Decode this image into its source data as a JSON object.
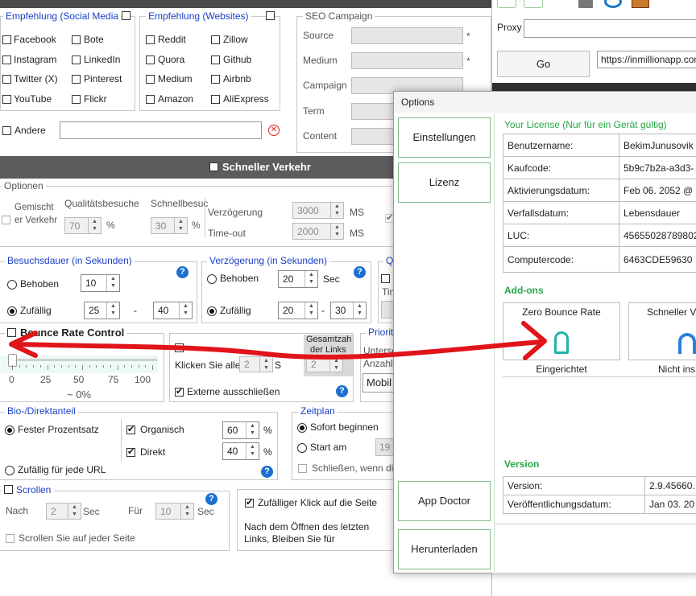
{
  "referral_social": {
    "title": "Empfehlung (Social Media",
    "items": [
      "Facebook",
      "Bote",
      "Instagram",
      "LinkedIn",
      "Twitter (X)",
      "Pinterest",
      "YouTube",
      "Flickr"
    ]
  },
  "referral_websites": {
    "title": "Empfehlung (Websites)",
    "items": [
      "Reddit",
      "Zillow",
      "Quora",
      "Github",
      "Medium",
      "Airbnb",
      "Amazon",
      "AliExpress"
    ]
  },
  "other_label": "Andere",
  "seo": {
    "title": "SEO Campaign",
    "fields": [
      "Source",
      "Medium",
      "Campaign",
      "Term",
      "Content"
    ],
    "required_mark": "*"
  },
  "fast_traffic": "Schneller Verkehr",
  "options": {
    "title": "Optionen",
    "weighted_traffic": "Gemischt er Verkehr",
    "quality_visits": "Qualitätsbesuche",
    "quality_value": "70",
    "fast_visits": "Schnellbesuc",
    "fast_value": "30",
    "percent": "%",
    "delay": "Verzögerung",
    "delay_value": "3000",
    "timeout": "Time-out",
    "timeout_value": "2000",
    "ms": "MS"
  },
  "visit_duration": {
    "title": "Besuchsdauer (in Sekunden)",
    "hold": "Behoben",
    "hold_value": "10",
    "random": "Zufällig",
    "min": "25",
    "dash": "-",
    "max": "40"
  },
  "delay_group": {
    "title": "Verzögerung (in Sekunden)",
    "hold": "Behoben",
    "hold_value": "20",
    "sec": "Sec",
    "random": "Zufällig",
    "min": "20",
    "dash": "-",
    "max": "30"
  },
  "bounce": {
    "title": "Bounce Rate Control",
    "ticks": [
      "0",
      "25",
      "50",
      "75",
      "100"
    ],
    "value_text": "~ 0%"
  },
  "clicks": {
    "click_all": "Klicken Sie alle",
    "click_value": "2",
    "s": "S",
    "total": "Gesamtzah",
    "of_links": "der Links",
    "total_value": "2",
    "exclude_external": "Externe ausschließen"
  },
  "priority": {
    "title": "Priorit",
    "under": "Untersc",
    "count": "Anzahl",
    "device": "Mobil"
  },
  "bio": {
    "title": "Bio-/Direktanteil",
    "fixed": "Fester Prozentsatz",
    "organic": "Organisch",
    "organic_value": "60",
    "direct": "Direkt",
    "direct_value": "40",
    "percent": "%",
    "random": "Zufällig für jede URL"
  },
  "schedule": {
    "title": "Zeitplan",
    "start_now": "Sofort beginnen",
    "start_at": "Start am",
    "start_value": "19",
    "close": "Schließen, wenn die"
  },
  "scroll": {
    "title": "Scrollen",
    "after": "Nach",
    "after_value": "2",
    "sec": "Sec",
    "for": "Für",
    "for_value": "10",
    "every_page": "Scrollen Sie auf jeder Seite"
  },
  "random_click": {
    "label": "Zufälliger Klick auf die Seite",
    "after_open": "Nach dem Öffnen des letzten",
    "links_stay": "Links, Bleiben Sie für"
  },
  "browser": {
    "proxy": "Proxy",
    "go": "Go",
    "url": "https://inmillionapp.com"
  },
  "dialog": {
    "title": "Options",
    "nav": [
      "Einstellungen",
      "Lizenz",
      "App Doctor",
      "Herunterladen"
    ],
    "license_title": "Your License (Nur für ein Gerät gültig)",
    "license_rows": [
      [
        "Benutzername:",
        "BekimJunusovik"
      ],
      [
        "Kaufcode:",
        "5b9c7b2a-a3d3-"
      ],
      [
        "Aktivierungsdatum:",
        "Feb 06. 2052 @"
      ],
      [
        "Verfallsdatum:",
        "Lebensdauer"
      ],
      [
        "LUC:",
        "45655028789802"
      ],
      [
        "Computercode:",
        "6463CDE59630"
      ]
    ],
    "addons_title": "Add-ons",
    "addons": [
      {
        "name": "Zero Bounce Rate",
        "status": "Eingerichtet"
      },
      {
        "name": "Schneller V",
        "status": "Nicht ins"
      }
    ],
    "version_title": "Version",
    "version_rows": [
      [
        "Version:",
        "2.9.45660."
      ],
      [
        "Veröffentlichungsdatum:",
        "Jan 03. 20"
      ]
    ]
  },
  "colors": {
    "accent_blue": "#1a3fc7",
    "license_green": "#24a845",
    "arrow_red": "#e0141a"
  }
}
